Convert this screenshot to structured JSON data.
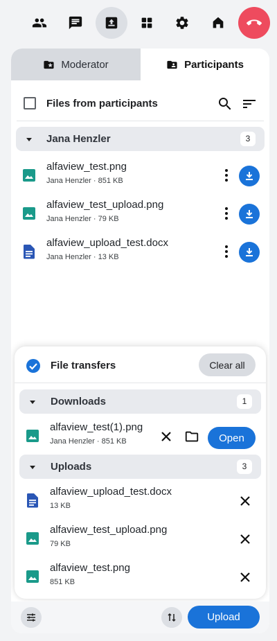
{
  "toolbar": {
    "items": [
      {
        "icon": "people-icon"
      },
      {
        "icon": "chat-icon"
      },
      {
        "icon": "file-upload-icon",
        "active": true
      },
      {
        "icon": "apps-icon"
      },
      {
        "icon": "gear-icon"
      },
      {
        "icon": "home-icon"
      },
      {
        "icon": "hangup-icon",
        "color": "#ee4b5e"
      }
    ]
  },
  "tabs": {
    "moderator": "Moderator",
    "participants": "Participants"
  },
  "files_header": {
    "title": "Files from participants"
  },
  "group": {
    "name": "Jana Henzler",
    "count": "3"
  },
  "files": [
    {
      "name": "alfaview_test.png",
      "meta": "Jana Henzler · 851 KB",
      "type": "image"
    },
    {
      "name": "alfaview_test_upload.png",
      "meta": "Jana Henzler · 79 KB",
      "type": "image"
    },
    {
      "name": "alfaview_upload_test.docx",
      "meta": "Jana Henzler · 13 KB",
      "type": "doc"
    }
  ],
  "transfers": {
    "title": "File transfers",
    "clear_all": "Clear all",
    "downloads_label": "Downloads",
    "downloads_count": "1",
    "downloads": [
      {
        "name": "alfaview_test(1).png",
        "meta": "Jana Henzler · 851 KB",
        "action": "Open"
      }
    ],
    "uploads_label": "Uploads",
    "uploads_count": "3",
    "uploads": [
      {
        "name": "alfaview_upload_test.docx",
        "meta": "13 KB",
        "type": "doc"
      },
      {
        "name": "alfaview_test_upload.png",
        "meta": "79 KB",
        "type": "image"
      },
      {
        "name": "alfaview_test.png",
        "meta": "851 KB",
        "type": "image"
      }
    ]
  },
  "bottom": {
    "upload": "Upload"
  },
  "colors": {
    "accent": "#1a73d9",
    "image_icon": "#1a9a8a",
    "doc_icon": "#2a56b5",
    "hangup": "#ee4b5e"
  }
}
